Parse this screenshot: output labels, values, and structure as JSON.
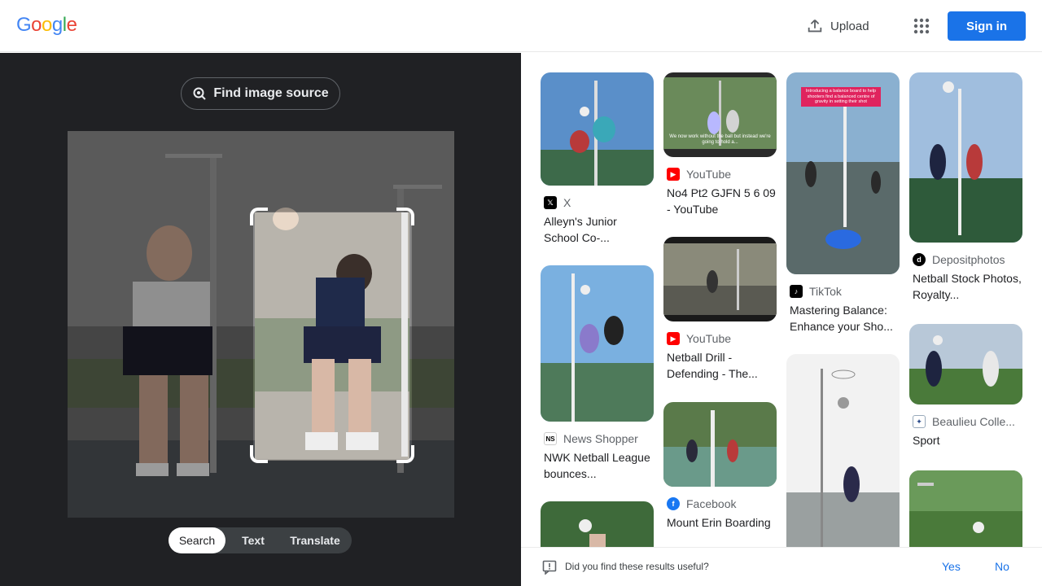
{
  "header": {
    "logo_letters": [
      "G",
      "o",
      "o",
      "g",
      "l",
      "e"
    ],
    "upload_label": "Upload",
    "signin_label": "Sign in"
  },
  "left": {
    "find_source_label": "Find image source",
    "modes": [
      "Search",
      "Text",
      "Translate"
    ],
    "active_mode": "Search"
  },
  "results": [
    {
      "source": "X",
      "title": "Alleyn's Junior School Co-..."
    },
    {
      "source": "YouTube",
      "title": "No4 Pt2 GJFN 5 6 09 - YouTube"
    },
    {
      "source": "TikTok",
      "title": "Mastering Balance: Enhance your Sho..."
    },
    {
      "source": "Depositphotos",
      "title": "Netball Stock Photos, Royalty..."
    },
    {
      "source": "News Shopper",
      "title": "NWK Netball League bounces..."
    },
    {
      "source": "YouTube",
      "title": "Netball Drill - Defending - The..."
    },
    {
      "source": "Beaulieu Colle...",
      "title": "Sport"
    },
    {
      "source": "Facebook",
      "title": "Mount Erin Boarding"
    }
  ],
  "thumb_captions": {
    "tiktok_banner": "Introducing a balance board to help shooters find a balanced centre of gravity in setting their shot",
    "youtube1_caption": "We now work without the ball but instead we're going to hold a..."
  },
  "feedback": {
    "question": "Did you find these results useful?",
    "yes": "Yes",
    "no": "No"
  },
  "colors": {
    "google_blue": "#4285F4",
    "google_red": "#EA4335",
    "google_yellow": "#FBBC05",
    "google_green": "#34A853",
    "accent": "#1a73e8",
    "youtube_red": "#FF0000",
    "facebook_blue": "#1877F2"
  }
}
